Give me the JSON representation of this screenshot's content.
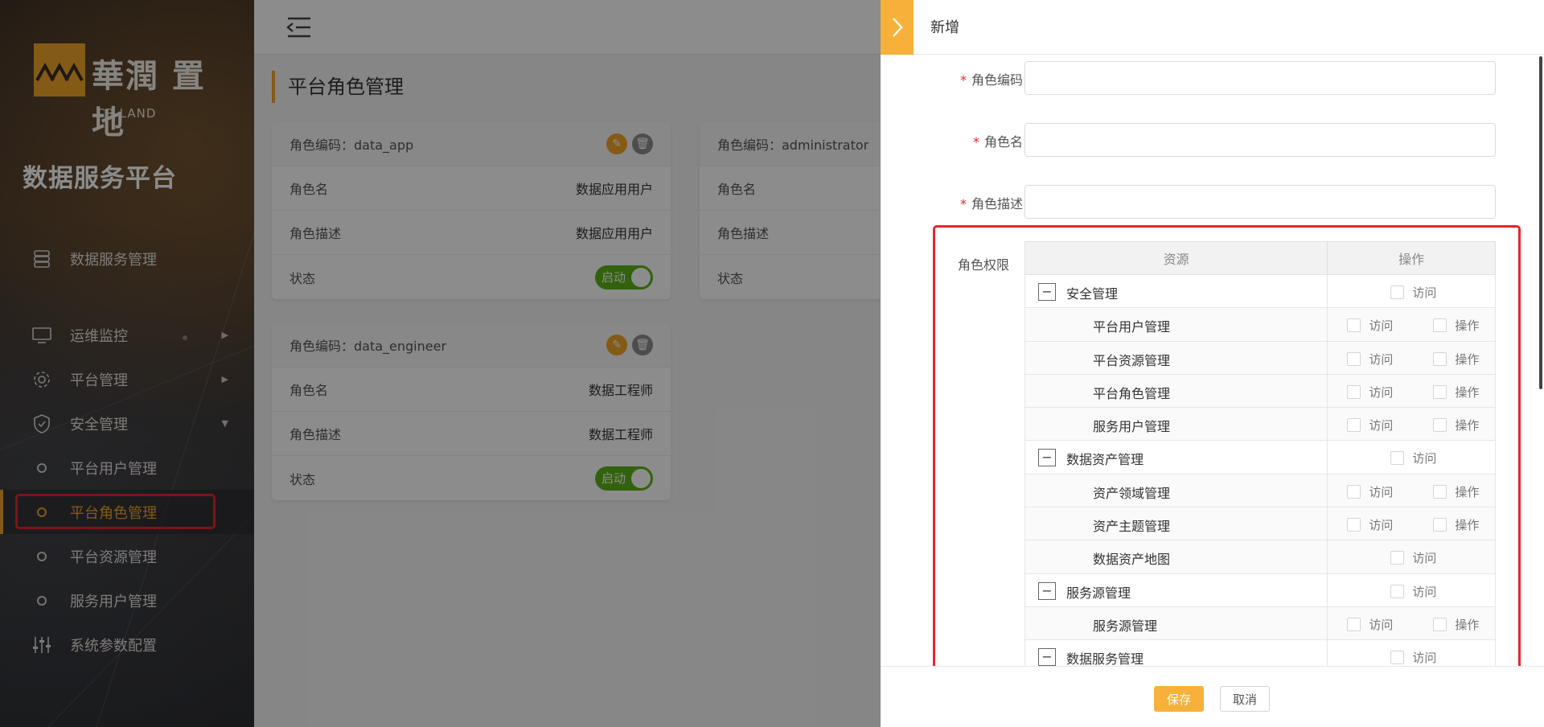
{
  "brand": {
    "cn": "華潤 置地",
    "en": "CR LAND"
  },
  "platform_title": "数据服务平台",
  "nav": {
    "data_service": "数据服务管理",
    "ops_monitor": "运维监控",
    "platform_mgmt": "平台管理",
    "security_mgmt": "安全管理",
    "security_children": [
      "平台用户管理",
      "平台角色管理",
      "平台资源管理",
      "服务用户管理"
    ],
    "sys_params": "系统参数配置",
    "active": "平台角色管理"
  },
  "page": {
    "title": "平台角色管理"
  },
  "cards": [
    {
      "code_label": "角色编码：data_app",
      "name_label": "角色名",
      "name_value": "数据应用用户",
      "desc_label": "角色描述",
      "desc_value": "数据应用用户",
      "status_label": "状态",
      "switch_text": "启动"
    },
    {
      "code_label": "角色编码：administrator",
      "name_label": "角色名",
      "desc_label": "角色描述",
      "status_label": "状态"
    },
    {
      "code_label": "角色编码：data_engineer",
      "name_label": "角色名",
      "name_value": "数据工程师",
      "desc_label": "角色描述",
      "desc_value": "数据工程师",
      "status_label": "状态",
      "switch_text": "启动"
    }
  ],
  "drawer": {
    "title": "新增",
    "fields": [
      {
        "label": "角色编码",
        "value": ""
      },
      {
        "label": "角色名",
        "value": ""
      },
      {
        "label": "角色描述",
        "value": ""
      }
    ],
    "perm_label": "角色权限",
    "table_headers": [
      "资源",
      "操作"
    ],
    "access_label": "访问",
    "operate_label": "操作",
    "rows": [
      {
        "name": "安全管理",
        "group": true
      },
      {
        "name": "平台用户管理",
        "group": false
      },
      {
        "name": "平台资源管理",
        "group": false
      },
      {
        "name": "平台角色管理",
        "group": false
      },
      {
        "name": "服务用户管理",
        "group": false
      },
      {
        "name": "数据资产管理",
        "group": true
      },
      {
        "name": "资产领域管理",
        "group": false
      },
      {
        "name": "资产主题管理",
        "group": false
      },
      {
        "name": "数据资产地图",
        "group": false,
        "access_only": true
      },
      {
        "name": "服务源管理",
        "group": true
      },
      {
        "name": "服务源管理",
        "group": false
      },
      {
        "name": "数据服务管理",
        "group": true
      }
    ],
    "save": "保存",
    "cancel": "取消"
  },
  "colors": {
    "accent": "#f7b13a",
    "brand_orange": "#f0a42a",
    "switch_on": "#5cb318",
    "highlight": "#e8242a"
  }
}
